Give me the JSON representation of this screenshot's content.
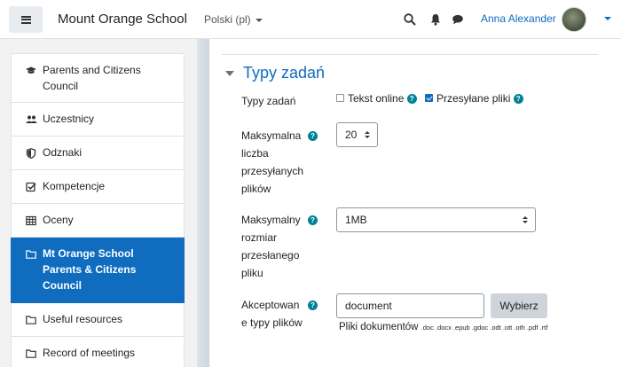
{
  "navbar": {
    "site_name": "Mount Orange School",
    "language": "Polski (pl)",
    "user_name": "Anna Alexander",
    "icons": [
      "menu-icon",
      "search-icon",
      "bell-icon",
      "chat-icon"
    ]
  },
  "drawer": {
    "items": [
      {
        "label": "Parents and Citizens Council",
        "icon": "graduation-cap-icon"
      },
      {
        "label": "Uczestnicy",
        "icon": "users-icon"
      },
      {
        "label": "Odznaki",
        "icon": "shield-icon"
      },
      {
        "label": "Kompetencje",
        "icon": "checkbox-icon"
      },
      {
        "label": "Oceny",
        "icon": "table-icon"
      },
      {
        "label": "Mt Orange School Parents & Citizens Council",
        "icon": "folder-icon",
        "active": true
      },
      {
        "label": "Useful resources",
        "icon": "folder-icon"
      },
      {
        "label": "Record of meetings",
        "icon": "folder-icon"
      }
    ]
  },
  "section": {
    "title": "Typy zadań"
  },
  "form": {
    "submission_types": {
      "label": "Typy zadań",
      "online_text": {
        "label": "Tekst online",
        "checked": false
      },
      "file_submissions": {
        "label": "Przesyłane pliki",
        "checked": true
      }
    },
    "max_files": {
      "label": "Maksymalna liczba przesyłanych plików",
      "label_lines": [
        "Maksymalna",
        "liczba",
        "przesyłanych",
        "plików"
      ],
      "value": "20"
    },
    "max_size": {
      "label": "Maksymalny rozmiar przesłanego pliku",
      "label_lines": [
        "Maksymalny",
        "rozmiar",
        "przesłanego",
        "pliku"
      ],
      "value": "1MB"
    },
    "accepted_types": {
      "label": "Akceptowane typy plików",
      "label_lines": [
        "Akceptowan",
        "e typy plików"
      ],
      "value": "document",
      "button": "Wybierz",
      "group_name": "Pliki dokumentów",
      "extensions": ".doc .docx .epub .gdoc .odt .ott .oth .pdf .rtf"
    }
  },
  "colors": {
    "accent": "#0f6cbf",
    "help": "#008196",
    "drawer_bg": "#f2f2f2"
  }
}
